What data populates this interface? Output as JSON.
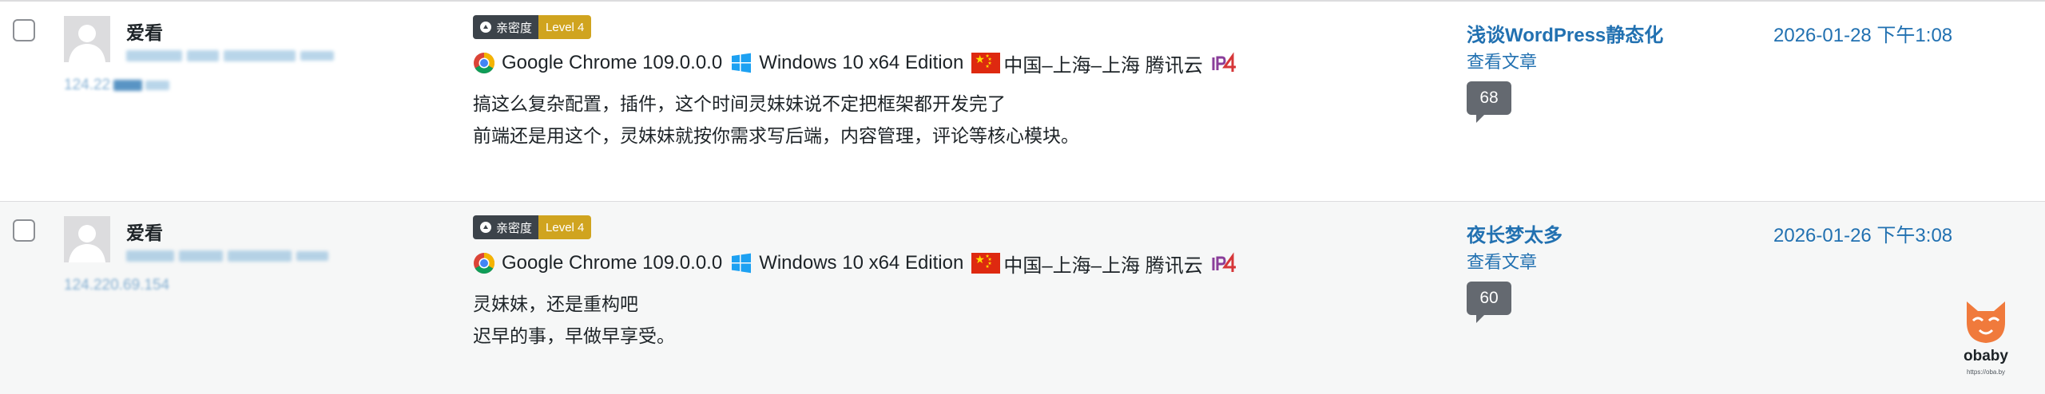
{
  "rows": [
    {
      "author": {
        "name": "爱看",
        "ip_visible": "124.22"
      },
      "badge": {
        "label": "亲密度",
        "level": "Level 4"
      },
      "env": {
        "browser": "Google Chrome 109.0.0.0",
        "os": "Windows 10 x64 Edition",
        "location": "中国–上海–上海 腾讯云"
      },
      "content": [
        "搞这么复杂配置，插件，这个时间灵妹妹说不定把框架都开发完了",
        "前端还是用这个，灵妹妹就按你需求写后端，内容管理，评论等核心模块。"
      ],
      "post": {
        "title": "浅谈WordPress静态化",
        "view_label": "查看文章",
        "count": "68"
      },
      "date": "2026-01-28 下午1:08"
    },
    {
      "author": {
        "name": "爱看",
        "ip_visible": "124.220.69.154"
      },
      "badge": {
        "label": "亲密度",
        "level": "Level 4"
      },
      "env": {
        "browser": "Google Chrome 109.0.0.0",
        "os": "Windows 10 x64 Edition",
        "location": "中国–上海–上海 腾讯云"
      },
      "content": [
        "灵妹妹，还是重构吧",
        "迟早的事，早做早享受。"
      ],
      "post": {
        "title": "夜长梦太多",
        "view_label": "查看文章",
        "count": "60"
      },
      "date": "2026-01-26 下午3:08"
    }
  ],
  "watermark": {
    "name": "obaby",
    "url": "https://oba.by"
  },
  "colors": {
    "link": "#2271b1",
    "badge_dark": "#3c434a",
    "badge_gold": "#d0a41f",
    "bubble": "#646970",
    "flag_red": "#de2910"
  },
  "icons": {
    "browser": "chrome-icon",
    "os": "windows-icon",
    "flag": "china-flag-icon",
    "network": "ipv4-icon"
  }
}
